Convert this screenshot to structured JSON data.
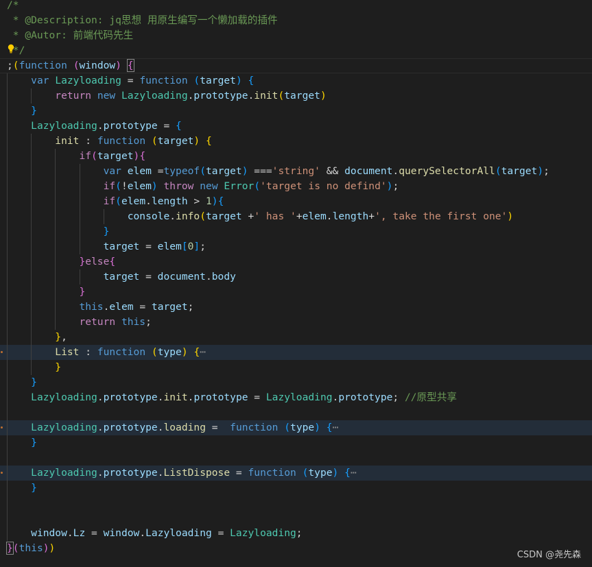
{
  "editor": {
    "theme_colors": {
      "background": "#1e1e1e",
      "comment": "#6a9955",
      "keyword": "#569cd6",
      "control": "#c586c0",
      "variable": "#9cdcfe",
      "type": "#4ec9b0",
      "function": "#dcdcaa",
      "string": "#ce9178",
      "number": "#b5cea8"
    },
    "highlighted_lines": [
      23,
      28,
      31
    ],
    "cursor_line": 4,
    "lines": [
      [
        [
          "/*",
          "c"
        ]
      ],
      [
        [
          " * @Description: jq思想 用原生编写一个懒加载的插件",
          "c"
        ]
      ],
      [
        [
          " * @Autor: 前端代码先生",
          "c"
        ]
      ],
      [
        [
          " */",
          "c"
        ]
      ],
      [
        [
          ";",
          "p"
        ],
        [
          "(",
          "b1"
        ],
        [
          "function",
          "k"
        ],
        [
          " ",
          "p"
        ],
        [
          "(",
          "b2"
        ],
        [
          "window",
          "v"
        ],
        [
          ")",
          "b2"
        ],
        [
          " ",
          "p"
        ],
        [
          "{",
          "b2 box"
        ]
      ],
      [
        [
          "    ",
          "p"
        ],
        [
          "var",
          "k"
        ],
        [
          " ",
          "p"
        ],
        [
          "Lazyloading",
          "t"
        ],
        [
          " = ",
          "p"
        ],
        [
          "function",
          "k"
        ],
        [
          " ",
          "p"
        ],
        [
          "(",
          "b3"
        ],
        [
          "target",
          "v"
        ],
        [
          ")",
          "b3"
        ],
        [
          " ",
          "p"
        ],
        [
          "{",
          "b3"
        ]
      ],
      [
        [
          "        ",
          "p"
        ],
        [
          "return",
          "ctl"
        ],
        [
          " ",
          "p"
        ],
        [
          "new",
          "k"
        ],
        [
          " ",
          "p"
        ],
        [
          "Lazyloading",
          "t"
        ],
        [
          ".",
          "p"
        ],
        [
          "prototype",
          "v"
        ],
        [
          ".",
          "p"
        ],
        [
          "init",
          "f"
        ],
        [
          "(",
          "b1"
        ],
        [
          "target",
          "v"
        ],
        [
          ")",
          "b1"
        ]
      ],
      [
        [
          "    ",
          "p"
        ],
        [
          "}",
          "b3"
        ]
      ],
      [
        [
          "    ",
          "p"
        ],
        [
          "Lazyloading",
          "t"
        ],
        [
          ".",
          "p"
        ],
        [
          "prototype",
          "v"
        ],
        [
          " = ",
          "p"
        ],
        [
          "{",
          "b3"
        ]
      ],
      [
        [
          "        ",
          "p"
        ],
        [
          "init",
          "f"
        ],
        [
          " : ",
          "p"
        ],
        [
          "function",
          "k"
        ],
        [
          " ",
          "p"
        ],
        [
          "(",
          "b1"
        ],
        [
          "target",
          "v"
        ],
        [
          ")",
          "b1"
        ],
        [
          " ",
          "p"
        ],
        [
          "{",
          "b1"
        ]
      ],
      [
        [
          "            ",
          "p"
        ],
        [
          "if",
          "ctl"
        ],
        [
          "(",
          "b2"
        ],
        [
          "target",
          "v"
        ],
        [
          ")",
          "b2"
        ],
        [
          "{",
          "b2"
        ]
      ],
      [
        [
          "                ",
          "p"
        ],
        [
          "var",
          "k"
        ],
        [
          " ",
          "p"
        ],
        [
          "elem",
          "v"
        ],
        [
          " =",
          "p"
        ],
        [
          "typeof",
          "k"
        ],
        [
          "(",
          "b3"
        ],
        [
          "target",
          "v"
        ],
        [
          ")",
          "b3"
        ],
        [
          " ===",
          "p"
        ],
        [
          "'string'",
          "s"
        ],
        [
          " && ",
          "p"
        ],
        [
          "document",
          "v"
        ],
        [
          ".",
          "p"
        ],
        [
          "querySelectorAll",
          "f"
        ],
        [
          "(",
          "b3"
        ],
        [
          "target",
          "v"
        ],
        [
          ")",
          "b3"
        ],
        [
          ";",
          "p"
        ]
      ],
      [
        [
          "                ",
          "p"
        ],
        [
          "if",
          "ctl"
        ],
        [
          "(",
          "b3"
        ],
        [
          "!",
          "p"
        ],
        [
          "elem",
          "v"
        ],
        [
          ")",
          "b3"
        ],
        [
          " ",
          "p"
        ],
        [
          "throw",
          "ctl"
        ],
        [
          " ",
          "p"
        ],
        [
          "new",
          "k"
        ],
        [
          " ",
          "p"
        ],
        [
          "Error",
          "t"
        ],
        [
          "(",
          "b3"
        ],
        [
          "'target is no defind'",
          "s"
        ],
        [
          ")",
          "b3"
        ],
        [
          ";",
          "p"
        ]
      ],
      [
        [
          "                ",
          "p"
        ],
        [
          "if",
          "ctl"
        ],
        [
          "(",
          "b3"
        ],
        [
          "elem",
          "v"
        ],
        [
          ".",
          "p"
        ],
        [
          "length",
          "v"
        ],
        [
          " > ",
          "p"
        ],
        [
          "1",
          "n"
        ],
        [
          ")",
          "b3"
        ],
        [
          "{",
          "b3"
        ]
      ],
      [
        [
          "                    ",
          "p"
        ],
        [
          "console",
          "v"
        ],
        [
          ".",
          "p"
        ],
        [
          "info",
          "f"
        ],
        [
          "(",
          "b1"
        ],
        [
          "target",
          "v"
        ],
        [
          " +",
          "p"
        ],
        [
          "' has '",
          "s"
        ],
        [
          "+",
          "p"
        ],
        [
          "elem",
          "v"
        ],
        [
          ".",
          "p"
        ],
        [
          "length",
          "v"
        ],
        [
          "+",
          "p"
        ],
        [
          "', take the first one'",
          "s"
        ],
        [
          ")",
          "b1"
        ]
      ],
      [
        [
          "                ",
          "p"
        ],
        [
          "}",
          "b3"
        ]
      ],
      [
        [
          "                ",
          "p"
        ],
        [
          "target",
          "v"
        ],
        [
          " = ",
          "p"
        ],
        [
          "elem",
          "v"
        ],
        [
          "[",
          "b3"
        ],
        [
          "0",
          "n"
        ],
        [
          "]",
          "b3"
        ],
        [
          ";",
          "p"
        ]
      ],
      [
        [
          "            ",
          "p"
        ],
        [
          "}",
          "b2"
        ],
        [
          "else",
          "ctl"
        ],
        [
          "{",
          "b2"
        ]
      ],
      [
        [
          "                ",
          "p"
        ],
        [
          "target",
          "v"
        ],
        [
          " = ",
          "p"
        ],
        [
          "document",
          "v"
        ],
        [
          ".",
          "p"
        ],
        [
          "body",
          "v"
        ]
      ],
      [
        [
          "            ",
          "p"
        ],
        [
          "}",
          "b2"
        ]
      ],
      [
        [
          "            ",
          "p"
        ],
        [
          "this",
          "k"
        ],
        [
          ".",
          "p"
        ],
        [
          "elem",
          "v"
        ],
        [
          " = ",
          "p"
        ],
        [
          "target",
          "v"
        ],
        [
          ";",
          "p"
        ]
      ],
      [
        [
          "            ",
          "p"
        ],
        [
          "return",
          "ctl"
        ],
        [
          " ",
          "p"
        ],
        [
          "this",
          "k"
        ],
        [
          ";",
          "p"
        ]
      ],
      [
        [
          "        ",
          "p"
        ],
        [
          "}",
          "b1"
        ],
        [
          ",",
          "p"
        ]
      ],
      [
        [
          "        ",
          "p"
        ],
        [
          "List",
          "f"
        ],
        [
          " : ",
          "p"
        ],
        [
          "function",
          "k"
        ],
        [
          " ",
          "p"
        ],
        [
          "(",
          "b1"
        ],
        [
          "type",
          "v"
        ],
        [
          ")",
          "b1"
        ],
        [
          " ",
          "p"
        ],
        [
          "{",
          "b1"
        ],
        [
          "⋯",
          "e"
        ]
      ],
      [
        [
          "        ",
          "p"
        ],
        [
          "}",
          "b1"
        ]
      ],
      [
        [
          "    ",
          "p"
        ],
        [
          "}",
          "b3"
        ]
      ],
      [
        [
          "    ",
          "p"
        ],
        [
          "Lazyloading",
          "t"
        ],
        [
          ".",
          "p"
        ],
        [
          "prototype",
          "v"
        ],
        [
          ".",
          "p"
        ],
        [
          "init",
          "f"
        ],
        [
          ".",
          "p"
        ],
        [
          "prototype",
          "v"
        ],
        [
          " = ",
          "p"
        ],
        [
          "Lazyloading",
          "t"
        ],
        [
          ".",
          "p"
        ],
        [
          "prototype",
          "v"
        ],
        [
          "; ",
          "p"
        ],
        [
          "//原型共享",
          "c"
        ]
      ],
      [],
      [
        [
          "    ",
          "p"
        ],
        [
          "Lazyloading",
          "t"
        ],
        [
          ".",
          "p"
        ],
        [
          "prototype",
          "v"
        ],
        [
          ".",
          "p"
        ],
        [
          "loading",
          "f"
        ],
        [
          " =  ",
          "p"
        ],
        [
          "function",
          "k"
        ],
        [
          " ",
          "p"
        ],
        [
          "(",
          "b3"
        ],
        [
          "type",
          "v"
        ],
        [
          ")",
          "b3"
        ],
        [
          " ",
          "p"
        ],
        [
          "{",
          "b3"
        ],
        [
          "⋯",
          "e"
        ]
      ],
      [
        [
          "    ",
          "p"
        ],
        [
          "}",
          "b3"
        ]
      ],
      [],
      [
        [
          "    ",
          "p"
        ],
        [
          "Lazyloading",
          "t"
        ],
        [
          ".",
          "p"
        ],
        [
          "prototype",
          "v"
        ],
        [
          ".",
          "p"
        ],
        [
          "ListDispose",
          "f"
        ],
        [
          " = ",
          "p"
        ],
        [
          "function",
          "k"
        ],
        [
          " ",
          "p"
        ],
        [
          "(",
          "b3"
        ],
        [
          "type",
          "v"
        ],
        [
          ")",
          "b3"
        ],
        [
          " ",
          "p"
        ],
        [
          "{",
          "b3"
        ],
        [
          "⋯",
          "e"
        ]
      ],
      [
        [
          "    ",
          "p"
        ],
        [
          "}",
          "b3"
        ]
      ],
      [],
      [],
      [
        [
          "    ",
          "p"
        ],
        [
          "window",
          "v"
        ],
        [
          ".",
          "p"
        ],
        [
          "Lz",
          "v"
        ],
        [
          " = ",
          "p"
        ],
        [
          "window",
          "v"
        ],
        [
          ".",
          "p"
        ],
        [
          "Lazyloading",
          "v"
        ],
        [
          " = ",
          "p"
        ],
        [
          "Lazyloading",
          "t"
        ],
        [
          ";",
          "p"
        ]
      ],
      [
        [
          "}",
          "b2 box"
        ],
        [
          "(",
          "b2"
        ],
        [
          "this",
          "k"
        ],
        [
          ")",
          "b2"
        ],
        [
          ")",
          "b1"
        ]
      ]
    ]
  },
  "watermark": "CSDN @尧先森"
}
